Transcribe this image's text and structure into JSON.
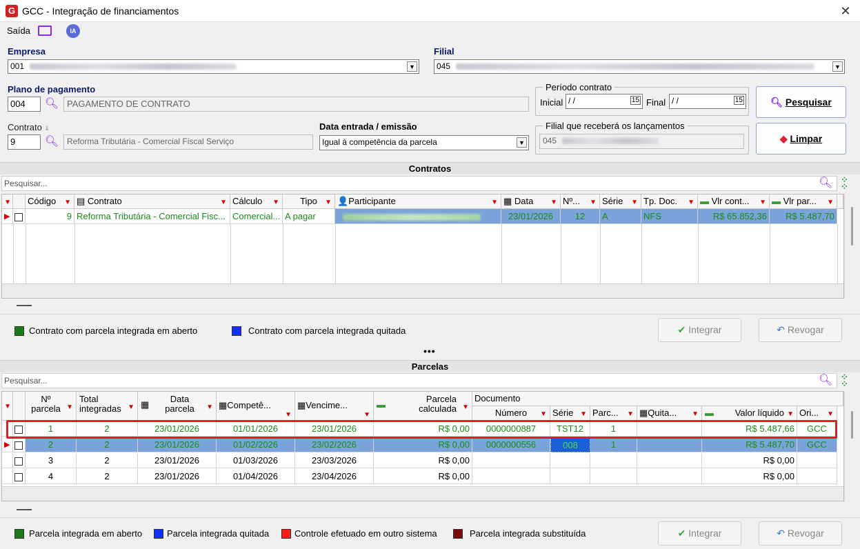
{
  "window": {
    "title": "GCC - Integração de financiamentos",
    "close": "✕",
    "logo": "G"
  },
  "toolbar": {
    "saida": "Saída",
    "ia": "IA"
  },
  "empresa": {
    "label": "Empresa",
    "code": "001"
  },
  "filial": {
    "label": "Filial",
    "code": "045"
  },
  "plano": {
    "label": "Plano de pagamento",
    "code": "004",
    "desc": "PAGAMENTO DE CONTRATO"
  },
  "periodo": {
    "label": "Período contrato",
    "inicial_label": "Inicial",
    "inicial": " / /",
    "final_label": "Final",
    "final": " / /"
  },
  "contrato": {
    "label": "Contrato",
    "code": "9",
    "desc": "Reforma Tributária - Comercial Fiscal Serviço"
  },
  "data_entrada": {
    "label": "Data entrada / emissão",
    "value": "Igual à competência da parcela"
  },
  "filial_lanc": {
    "label": "Filial que receberá os lançamentos",
    "code": "045"
  },
  "buttons": {
    "pesquisar": "Pesquisar",
    "limpar": "Limpar",
    "integrar": "Integrar",
    "revogar": "Revogar"
  },
  "contratos": {
    "title": "Contratos",
    "search_placeholder": "Pesquisar...",
    "headers": [
      "Código",
      "Contrato",
      "Cálculo",
      "Tipo",
      "Participante",
      "Data",
      "Nº...",
      "Série",
      "Tp. Doc.",
      "Vlr cont...",
      "Vlr par..."
    ],
    "rows": [
      {
        "codigo": "9",
        "contrato": "Reforma Tributária - Comercial Fisc...",
        "calculo": "Comercial...",
        "tipo": "A pagar",
        "data": "23/01/2026",
        "num": "12",
        "serie": "A",
        "tpdoc": "NFS",
        "vlrcont": "R$ 65.852,36",
        "vlrpar": "R$ 5.487,70"
      }
    ],
    "legend": [
      "Contrato com parcela integrada em aberto",
      "Contrato com parcela integrada quitada"
    ]
  },
  "parcelas": {
    "title": "Parcelas",
    "search_placeholder": "Pesquisar...",
    "headers": {
      "nparcela": "Nº parcela",
      "total": "Total integradas",
      "data": "Data parcela",
      "compet": "Competê...",
      "venc": "Vencime...",
      "calc": "Parcela calculada",
      "documento": "Documento",
      "numero": "Número",
      "serie": "Série",
      "parc": "Parc...",
      "quita": "Quita...",
      "valor": "Valor líquido",
      "ori": "Ori..."
    },
    "rows": [
      {
        "n": "1",
        "total": "2",
        "data": "23/01/2026",
        "comp": "01/01/2026",
        "venc": "23/01/2026",
        "calc": "R$ 0,00",
        "num": "0000000887",
        "serie": "TST12",
        "parc": "1",
        "quita": "",
        "valor": "R$ 5.487,66",
        "ori": "GCC"
      },
      {
        "n": "2",
        "total": "2",
        "data": "23/01/2026",
        "comp": "01/02/2026",
        "venc": "23/02/2026",
        "calc": "R$ 0,00",
        "num": "0000000556",
        "serie": "008",
        "parc": "1",
        "quita": "",
        "valor": "R$ 5.487,70",
        "ori": "GCC"
      },
      {
        "n": "3",
        "total": "2",
        "data": "23/01/2026",
        "comp": "01/03/2026",
        "venc": "23/03/2026",
        "calc": "R$ 0,00",
        "num": "",
        "serie": "",
        "parc": "",
        "quita": "",
        "valor": "R$ 0,00",
        "ori": ""
      },
      {
        "n": "4",
        "total": "2",
        "data": "23/01/2026",
        "comp": "01/04/2026",
        "venc": "23/04/2026",
        "calc": "R$ 0,00",
        "num": "",
        "serie": "",
        "parc": "",
        "quita": "",
        "valor": "R$ 0,00",
        "ori": ""
      }
    ],
    "legend": [
      "Parcela integrada em aberto",
      "Parcela integrada quitada",
      "Controle efetuado em outro sistema",
      "Parcela integrada substituída"
    ]
  },
  "colors": {
    "green": "#1a7a1a",
    "blue": "#1030ff",
    "red": "#ff1a1a",
    "maroon": "#7a0a0a",
    "highlight": "#e02020"
  }
}
